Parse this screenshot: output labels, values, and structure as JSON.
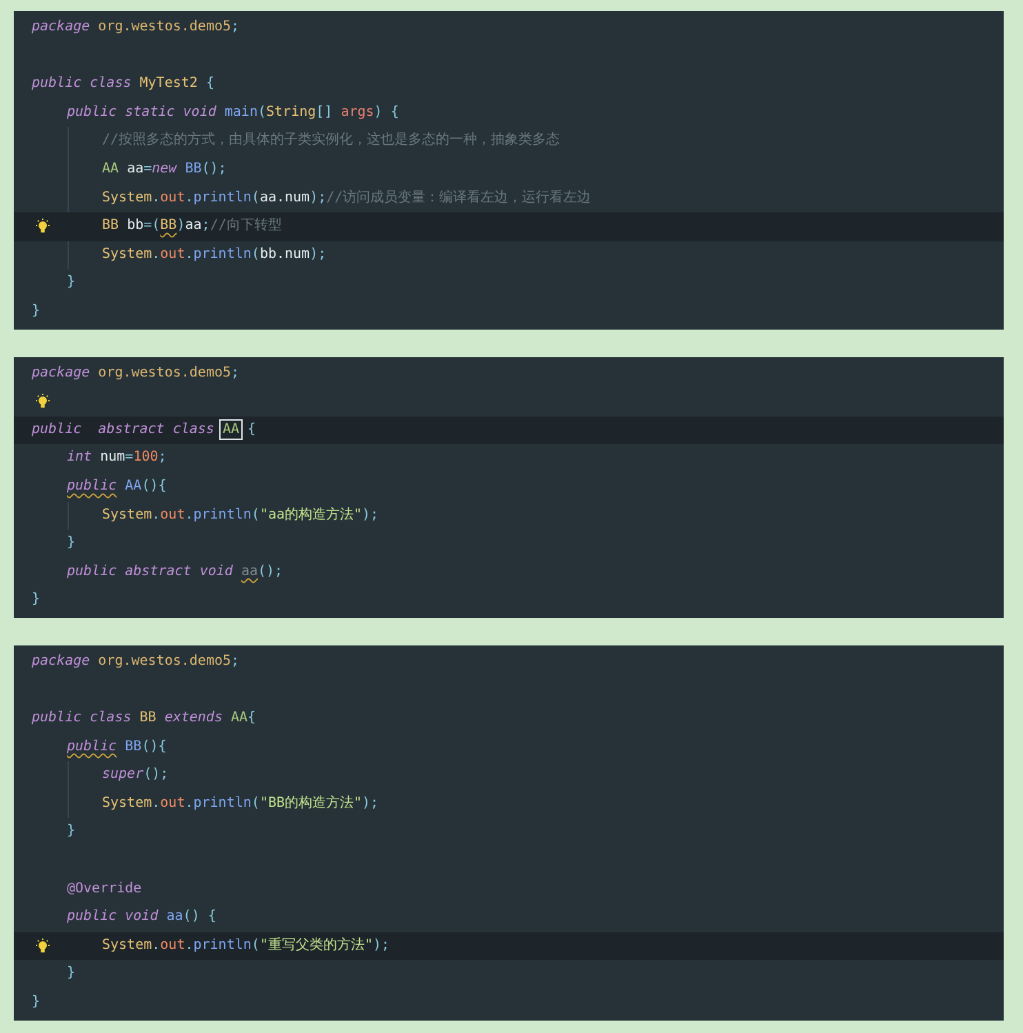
{
  "panels": [
    {
      "lines": [
        {
          "kind": "code",
          "current": false,
          "bulb": false,
          "tokens": [
            {
              "text": "package",
              "kind": "kw"
            },
            {
              "text": " org.westos.demo5",
              "kind": "pkg"
            },
            {
              "text": ";",
              "kind": "punct"
            }
          ]
        },
        {
          "kind": "blank",
          "current": false,
          "bulb": false
        },
        {
          "kind": "code",
          "current": false,
          "bulb": false,
          "tokens": [
            {
              "text": "public class",
              "kind": "kw"
            },
            {
              "text": " MyTest2",
              "kind": "cls"
            },
            {
              "text": " {",
              "kind": "punct"
            }
          ],
          "children": [
            {
              "kind": "code",
              "current": false,
              "bulb": false,
              "tokens": [
                {
                  "text": "public static void",
                  "kind": "kw"
                },
                {
                  "text": " main",
                  "kind": "fn"
                },
                {
                  "text": "(",
                  "kind": "punct"
                },
                {
                  "text": "String",
                  "kind": "cls"
                },
                {
                  "text": "[]",
                  "kind": "punct"
                },
                {
                  "text": " args",
                  "kind": "param"
                },
                {
                  "text": ") {",
                  "kind": "punct"
                }
              ],
              "children": [
                {
                  "kind": "code",
                  "current": false,
                  "bulb": false,
                  "tokens": [
                    {
                      "text": "//按照多态的方式，由具体的子类实例化，这也是多态的一种，抽象类多态",
                      "kind": "comment"
                    }
                  ]
                },
                {
                  "kind": "code",
                  "current": false,
                  "bulb": false,
                  "tokens": [
                    {
                      "text": "AA",
                      "kind": "type"
                    },
                    {
                      "text": " aa",
                      "kind": "plain"
                    },
                    {
                      "text": "=",
                      "kind": "punct"
                    },
                    {
                      "text": "new",
                      "kind": "kw"
                    },
                    {
                      "text": " BB",
                      "kind": "fn"
                    },
                    {
                      "text": "();",
                      "kind": "punct"
                    }
                  ]
                },
                {
                  "kind": "code",
                  "current": false,
                  "bulb": false,
                  "tokens": [
                    {
                      "text": "System",
                      "kind": "cls"
                    },
                    {
                      "text": ".",
                      "kind": "punct"
                    },
                    {
                      "text": "out",
                      "kind": "field"
                    },
                    {
                      "text": ".",
                      "kind": "punct"
                    },
                    {
                      "text": "println",
                      "kind": "fn"
                    },
                    {
                      "text": "(",
                      "kind": "punct"
                    },
                    {
                      "text": "aa.num",
                      "kind": "plain"
                    },
                    {
                      "text": ");",
                      "kind": "punct"
                    },
                    {
                      "text": "//访问成员变量：编译看左边，运行看左边",
                      "kind": "comment"
                    }
                  ]
                },
                {
                  "kind": "code",
                  "current": true,
                  "bulb": true,
                  "tokens": [
                    {
                      "text": "BB",
                      "kind": "cls"
                    },
                    {
                      "text": " bb",
                      "kind": "plain"
                    },
                    {
                      "text": "=(",
                      "kind": "punct"
                    },
                    {
                      "text": "BB",
                      "kind": "cls",
                      "warn": true
                    },
                    {
                      "text": ")",
                      "kind": "punct"
                    },
                    {
                      "text": "aa",
                      "kind": "plain"
                    },
                    {
                      "text": ";",
                      "kind": "punct"
                    },
                    {
                      "text": "//向下转型",
                      "kind": "comment"
                    }
                  ]
                },
                {
                  "kind": "code",
                  "current": false,
                  "bulb": false,
                  "tokens": [
                    {
                      "text": "System",
                      "kind": "cls"
                    },
                    {
                      "text": ".",
                      "kind": "punct"
                    },
                    {
                      "text": "out",
                      "kind": "field"
                    },
                    {
                      "text": ".",
                      "kind": "punct"
                    },
                    {
                      "text": "println",
                      "kind": "fn"
                    },
                    {
                      "text": "(",
                      "kind": "punct"
                    },
                    {
                      "text": "bb.num",
                      "kind": "plain"
                    },
                    {
                      "text": ");",
                      "kind": "punct"
                    }
                  ]
                }
              ]
            },
            {
              "kind": "code",
              "current": false,
              "bulb": false,
              "tokens": [
                {
                  "text": "}",
                  "kind": "punct"
                }
              ]
            }
          ]
        },
        {
          "kind": "code",
          "current": false,
          "bulb": false,
          "tokens": [
            {
              "text": "}",
              "kind": "punct"
            }
          ]
        }
      ]
    },
    {
      "lines": [
        {
          "kind": "code",
          "current": false,
          "bulb": false,
          "tokens": [
            {
              "text": "package",
              "kind": "kw"
            },
            {
              "text": " org.westos.demo5",
              "kind": "pkg"
            },
            {
              "text": ";",
              "kind": "punct"
            }
          ]
        },
        {
          "kind": "blank",
          "current": false,
          "bulb": true
        },
        {
          "kind": "code",
          "current": true,
          "bulb": false,
          "tokens": [
            {
              "text": "public  abstract class ",
              "kind": "kw"
            },
            {
              "text": "AA",
              "kind": "type",
              "boxed": true
            },
            {
              "text": " {",
              "kind": "punct"
            }
          ],
          "children": [
            {
              "kind": "code",
              "current": false,
              "bulb": false,
              "tokens": [
                {
                  "text": "int",
                  "kind": "kw"
                },
                {
                  "text": " num",
                  "kind": "plain"
                },
                {
                  "text": "=",
                  "kind": "punct"
                },
                {
                  "text": "100",
                  "kind": "num"
                },
                {
                  "text": ";",
                  "kind": "punct"
                }
              ]
            },
            {
              "kind": "code",
              "current": false,
              "bulb": false,
              "tokens": [
                {
                  "text": "public",
                  "kind": "kw",
                  "warn": true
                },
                {
                  "text": " AA",
                  "kind": "fn"
                },
                {
                  "text": "(){",
                  "kind": "punct"
                }
              ],
              "children": [
                {
                  "kind": "code",
                  "current": false,
                  "bulb": false,
                  "tokens": [
                    {
                      "text": "System",
                      "kind": "cls"
                    },
                    {
                      "text": ".",
                      "kind": "punct"
                    },
                    {
                      "text": "out",
                      "kind": "field"
                    },
                    {
                      "text": ".",
                      "kind": "punct"
                    },
                    {
                      "text": "println",
                      "kind": "fn"
                    },
                    {
                      "text": "(",
                      "kind": "punct"
                    },
                    {
                      "text": "\"aa的构造方法\"",
                      "kind": "str"
                    },
                    {
                      "text": ");",
                      "kind": "punct"
                    }
                  ]
                }
              ]
            },
            {
              "kind": "code",
              "current": false,
              "bulb": false,
              "tokens": [
                {
                  "text": "}",
                  "kind": "punct"
                }
              ]
            },
            {
              "kind": "code",
              "current": false,
              "bulb": false,
              "tokens": [
                {
                  "text": "public abstract void ",
                  "kind": "kw"
                },
                {
                  "text": "aa",
                  "kind": "unused",
                  "warn": true
                },
                {
                  "text": "();",
                  "kind": "punct"
                }
              ]
            }
          ]
        },
        {
          "kind": "code",
          "current": false,
          "bulb": false,
          "tokens": [
            {
              "text": "}",
              "kind": "punct"
            }
          ]
        }
      ]
    },
    {
      "lines": [
        {
          "kind": "code",
          "current": false,
          "bulb": false,
          "tokens": [
            {
              "text": "package",
              "kind": "kw"
            },
            {
              "text": " org.westos.demo5",
              "kind": "pkg"
            },
            {
              "text": ";",
              "kind": "punct"
            }
          ]
        },
        {
          "kind": "blank",
          "current": false,
          "bulb": false
        },
        {
          "kind": "code",
          "current": false,
          "bulb": false,
          "tokens": [
            {
              "text": "public class",
              "kind": "kw"
            },
            {
              "text": " BB",
              "kind": "cls"
            },
            {
              "text": " extends",
              "kind": "kw"
            },
            {
              "text": " AA",
              "kind": "type"
            },
            {
              "text": "{",
              "kind": "punct"
            }
          ],
          "children": [
            {
              "kind": "code",
              "current": false,
              "bulb": false,
              "tokens": [
                {
                  "text": "public",
                  "kind": "kw",
                  "warn": true
                },
                {
                  "text": " BB",
                  "kind": "fn"
                },
                {
                  "text": "(){",
                  "kind": "punct"
                }
              ],
              "children": [
                {
                  "kind": "code",
                  "current": false,
                  "bulb": false,
                  "tokens": [
                    {
                      "text": "super",
                      "kind": "kw"
                    },
                    {
                      "text": "();",
                      "kind": "punct"
                    }
                  ]
                },
                {
                  "kind": "code",
                  "current": false,
                  "bulb": false,
                  "tokens": [
                    {
                      "text": "System",
                      "kind": "cls"
                    },
                    {
                      "text": ".",
                      "kind": "punct"
                    },
                    {
                      "text": "out",
                      "kind": "field"
                    },
                    {
                      "text": ".",
                      "kind": "punct"
                    },
                    {
                      "text": "println",
                      "kind": "fn"
                    },
                    {
                      "text": "(",
                      "kind": "punct"
                    },
                    {
                      "text": "\"BB的构造方法\"",
                      "kind": "str"
                    },
                    {
                      "text": ");",
                      "kind": "punct"
                    }
                  ]
                }
              ]
            },
            {
              "kind": "code",
              "current": false,
              "bulb": false,
              "tokens": [
                {
                  "text": "}",
                  "kind": "punct"
                }
              ]
            },
            {
              "kind": "blank",
              "current": false,
              "bulb": false
            },
            {
              "kind": "code",
              "current": false,
              "bulb": false,
              "tokens": [
                {
                  "text": "@Override",
                  "kind": "ann"
                }
              ]
            },
            {
              "kind": "code",
              "current": false,
              "bulb": false,
              "tokens": [
                {
                  "text": "public void",
                  "kind": "kw"
                },
                {
                  "text": " aa",
                  "kind": "fn"
                },
                {
                  "text": "() {",
                  "kind": "punct"
                }
              ],
              "children": [
                {
                  "kind": "code",
                  "current": true,
                  "bulb": true,
                  "tokens": [
                    {
                      "text": "System",
                      "kind": "cls"
                    },
                    {
                      "text": ".",
                      "kind": "punct"
                    },
                    {
                      "text": "out",
                      "kind": "field"
                    },
                    {
                      "text": ".",
                      "kind": "punct"
                    },
                    {
                      "text": "println",
                      "kind": "fn"
                    },
                    {
                      "text": "(",
                      "kind": "punct"
                    },
                    {
                      "text": "\"重写父类的方法\"",
                      "kind": "str"
                    },
                    {
                      "text": ");",
                      "kind": "punct"
                    }
                  ]
                }
              ]
            },
            {
              "kind": "code",
              "current": false,
              "bulb": false,
              "tokens": [
                {
                  "text": "}",
                  "kind": "punct"
                }
              ]
            }
          ]
        },
        {
          "kind": "code",
          "current": false,
          "bulb": false,
          "tokens": [
            {
              "text": "}",
              "kind": "punct"
            }
          ]
        }
      ]
    }
  ]
}
